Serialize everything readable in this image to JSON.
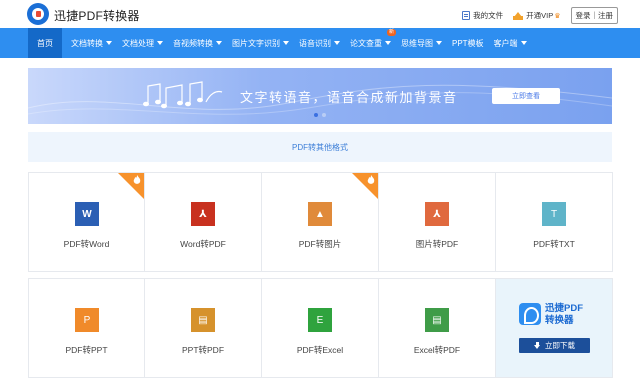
{
  "header": {
    "brand": "迅捷PDF转换器",
    "my_files": "我的文件",
    "open_vip": "开通VIP",
    "vip_badge": "♛",
    "login": "登录｜注册"
  },
  "nav": {
    "items": [
      {
        "label": "首页",
        "active": true,
        "dropdown": false
      },
      {
        "label": "文档转换",
        "dropdown": true
      },
      {
        "label": "文档处理",
        "dropdown": true
      },
      {
        "label": "音视频转换",
        "dropdown": true
      },
      {
        "label": "图片文字识别",
        "dropdown": true
      },
      {
        "label": "语音识别",
        "dropdown": true
      },
      {
        "label": "论文查重",
        "dropdown": true,
        "badge": "新"
      },
      {
        "label": "思维导图",
        "dropdown": true
      },
      {
        "label": "PPT模板",
        "dropdown": false
      },
      {
        "label": "客户端",
        "dropdown": true
      }
    ]
  },
  "banner": {
    "text": "文字转语音，语音合成新加背景音",
    "button": "立即查看"
  },
  "strip": {
    "label": "PDF转其他格式"
  },
  "tools": [
    {
      "label": "PDF转Word",
      "tile_text": "W",
      "color": "#2b5fb4",
      "hot": true
    },
    {
      "label": "Word转PDF",
      "tile_text": "⅄",
      "color": "#c8311f",
      "hot": false
    },
    {
      "label": "PDF转图片",
      "tile_text": "▲",
      "color": "#e08a3a",
      "hot": true
    },
    {
      "label": "图片转PDF",
      "tile_text": "⅄",
      "color": "#e0693e",
      "hot": false
    },
    {
      "label": "PDF转TXT",
      "tile_text": "T",
      "color": "#5fb4c9",
      "hot": false
    },
    {
      "label": "PDF转PPT",
      "tile_text": "P",
      "color": "#f08a2a",
      "hot": false
    },
    {
      "label": "PPT转PDF",
      "tile_text": "▤",
      "color": "#d6922c",
      "hot": false
    },
    {
      "label": "PDF转Excel",
      "tile_text": "E",
      "color": "#2fa33e",
      "hot": false
    },
    {
      "label": "Excel转PDF",
      "tile_text": "▤",
      "color": "#3f9c48",
      "hot": false
    }
  ],
  "promo": {
    "title_line1": "迅捷PDF",
    "title_line2": "转换器",
    "download": "立即下载"
  },
  "colors": {
    "nav_bg": "#2e8ef0",
    "nav_active": "#1469c8",
    "hot_badge": "#f7922c"
  }
}
